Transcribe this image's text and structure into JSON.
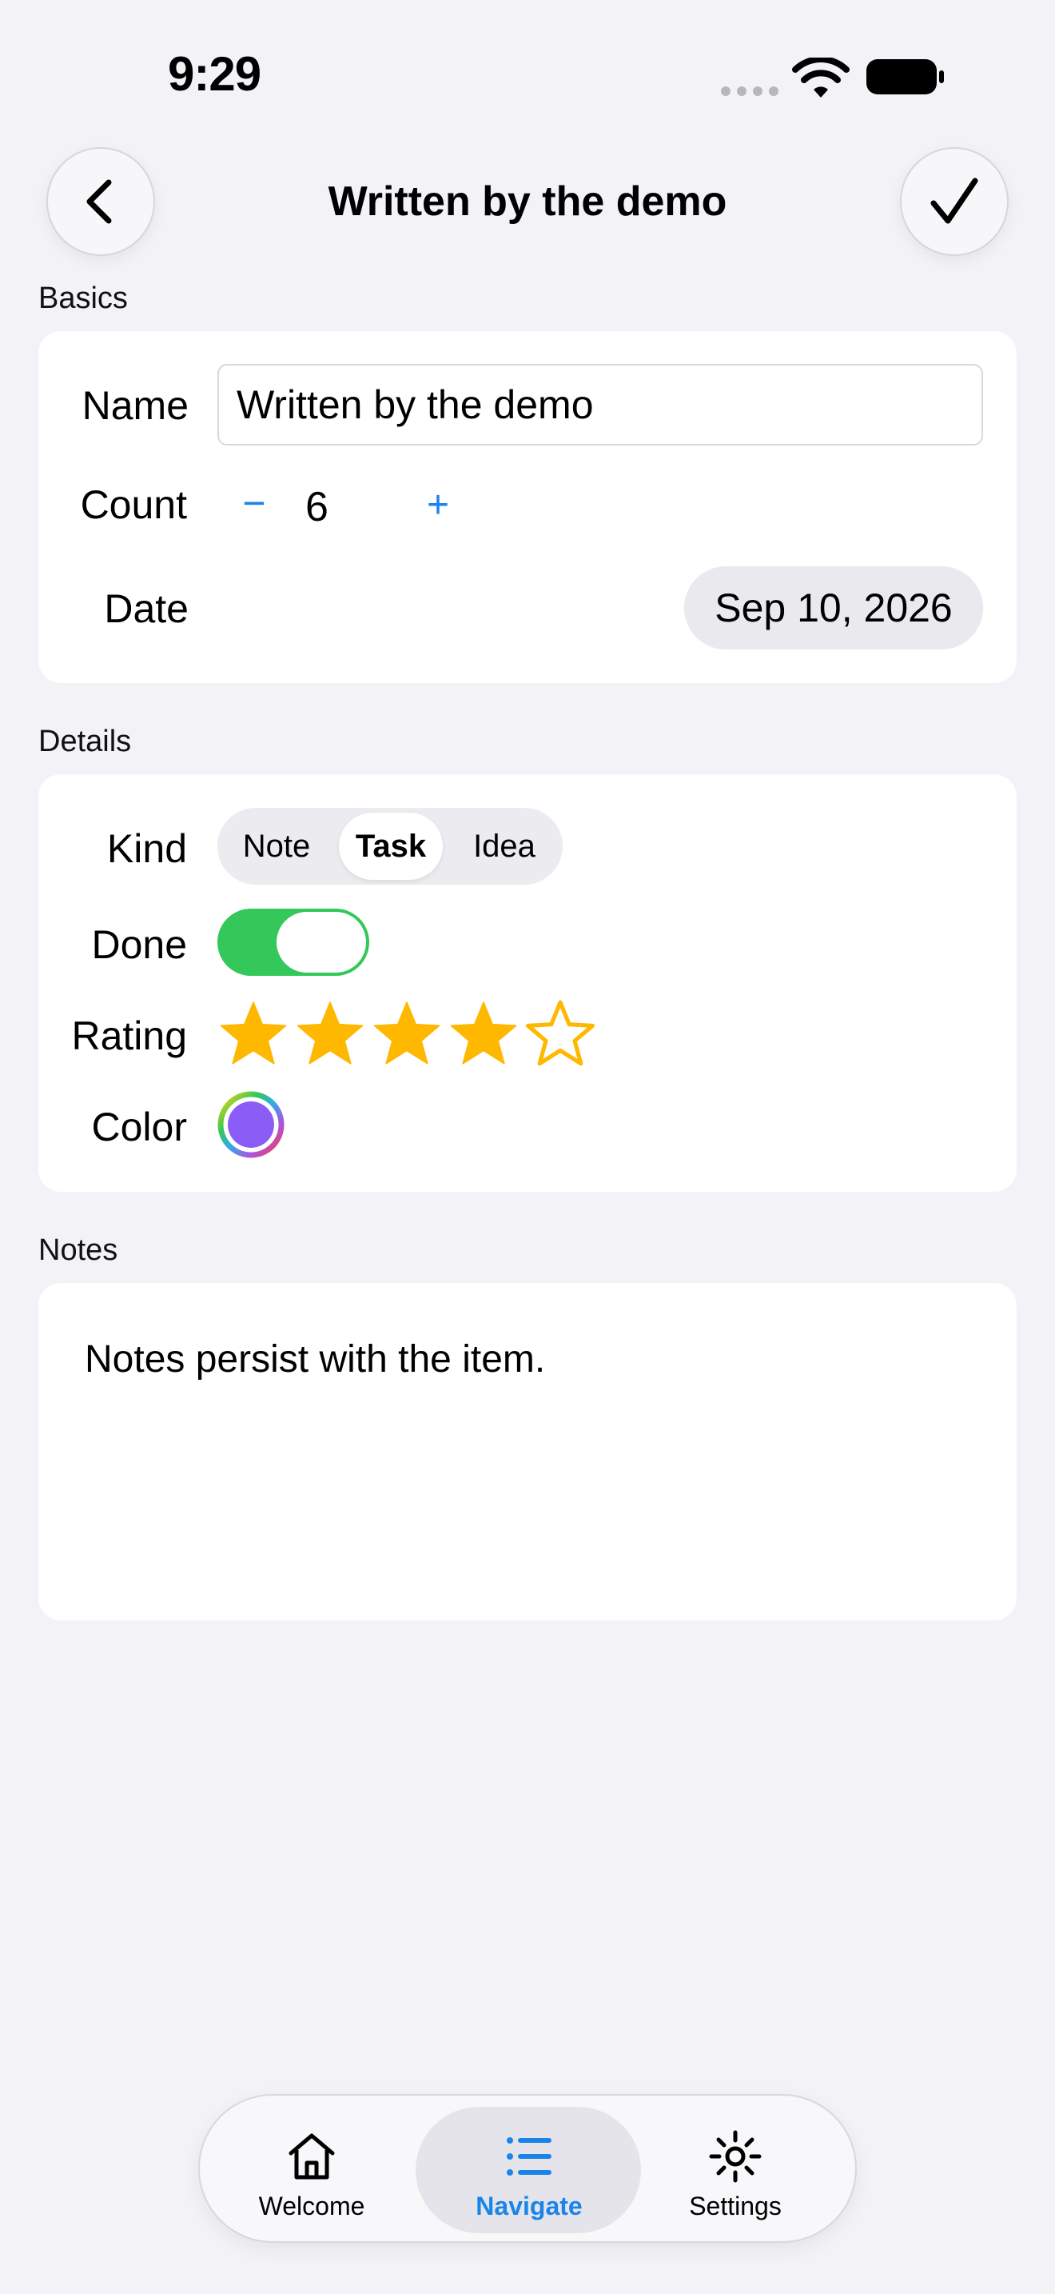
{
  "status_bar": {
    "time": "9:29"
  },
  "nav": {
    "title": "Written by the demo",
    "back_icon": "chevron-left-icon",
    "done_icon": "checkmark-icon"
  },
  "sections": {
    "basics": "Basics",
    "details": "Details",
    "notes": "Notes"
  },
  "basics": {
    "name_label": "Name",
    "name_value": "Written by the demo",
    "count_label": "Count",
    "count_minus": "−",
    "count_value": "6",
    "count_plus": "+",
    "date_label": "Date",
    "date_value": "Sep 10, 2026"
  },
  "details": {
    "kind_label": "Kind",
    "kind_options": [
      "Note",
      "Task",
      "Idea"
    ],
    "kind_selected": "Task",
    "done_label": "Done",
    "done_on": true,
    "rating_label": "Rating",
    "rating_value": 4,
    "rating_max": 5,
    "color_label": "Color",
    "color_value": "#8b5cf6"
  },
  "notes": {
    "text": "Notes persist with the item."
  },
  "tabbar": {
    "items": [
      {
        "label": "Welcome",
        "icon": "house-icon",
        "selected": false
      },
      {
        "label": "Navigate",
        "icon": "list-icon",
        "selected": true
      },
      {
        "label": "Settings",
        "icon": "gear-icon",
        "selected": false
      }
    ]
  },
  "colors": {
    "accent": "#1a84ea",
    "toggle_on": "#34c759",
    "star": "#ffb800",
    "background": "#f2f2f7"
  }
}
